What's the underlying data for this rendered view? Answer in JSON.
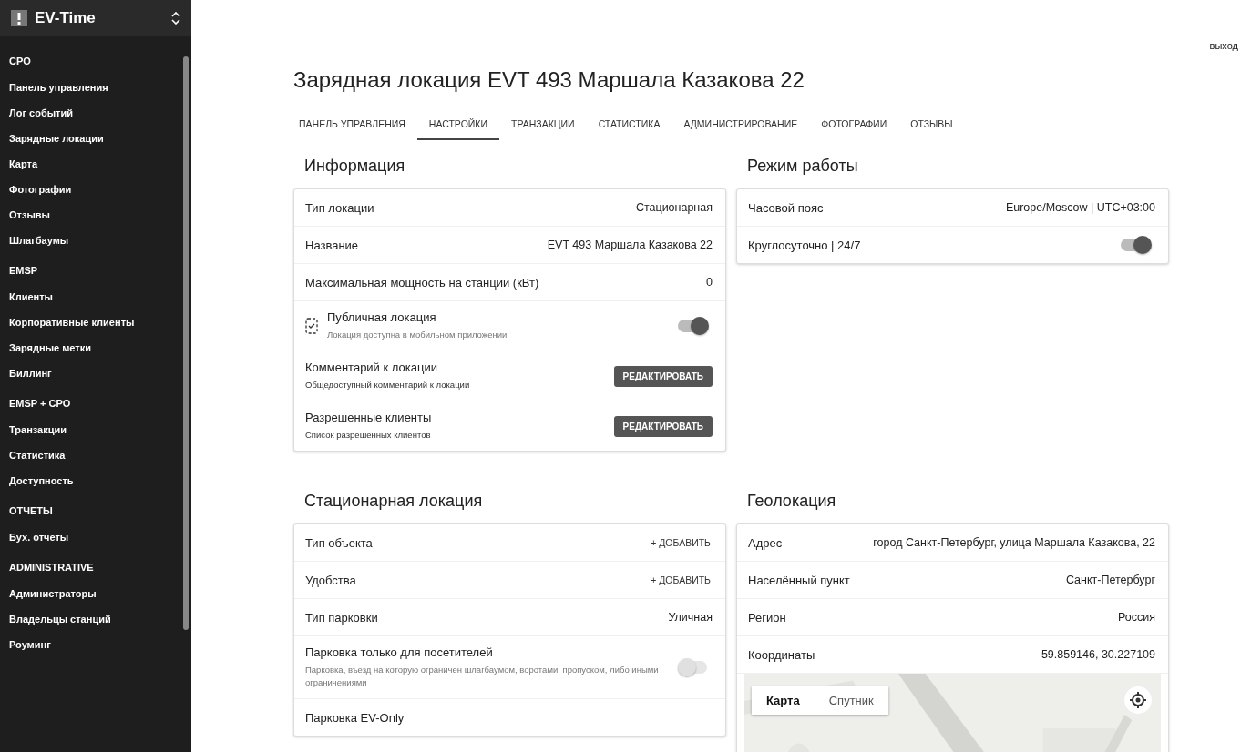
{
  "sidebar": {
    "brand": "EV-Time",
    "sections": [
      {
        "title": "CPO",
        "items": [
          {
            "label": "Панель управления"
          },
          {
            "label": "Лог событий"
          },
          {
            "label": "Зарядные локации"
          },
          {
            "label": "Карта"
          },
          {
            "label": "Фотографии"
          },
          {
            "label": "Отзывы"
          },
          {
            "label": "Шлагбаумы"
          }
        ]
      },
      {
        "title": "EMSP",
        "items": [
          {
            "label": "Клиенты"
          },
          {
            "label": "Корпоративные клиенты"
          },
          {
            "label": "Зарядные метки"
          },
          {
            "label": "Биллинг"
          }
        ]
      },
      {
        "title": "EMSP + CPO",
        "items": [
          {
            "label": "Транзакции"
          },
          {
            "label": "Статистика"
          },
          {
            "label": "Доступность"
          }
        ]
      },
      {
        "title": "ОТЧЕТЫ",
        "items": [
          {
            "label": "Бух. отчеты"
          }
        ]
      },
      {
        "title": "ADMINISTRATIVE",
        "items": [
          {
            "label": "Администраторы"
          },
          {
            "label": "Владельцы станций"
          },
          {
            "label": "Роуминг"
          }
        ]
      }
    ]
  },
  "logout": "выход",
  "title": "Зарядная локация EVT 493 Маршала Казакова 22",
  "tabs": [
    {
      "label": "ПАНЕЛЬ УПРАВЛЕНИЯ",
      "selected": false
    },
    {
      "label": "НАСТРОЙКИ",
      "selected": true
    },
    {
      "label": "ТРАНЗАКЦИИ",
      "selected": false
    },
    {
      "label": "СТАТИСТИКА",
      "selected": false
    },
    {
      "label": "АДМИНИСТРИРОВАНИЕ",
      "selected": false
    },
    {
      "label": "ФОТОГРАФИИ",
      "selected": false
    },
    {
      "label": "ОТЗЫВЫ",
      "selected": false
    }
  ],
  "left": [
    {
      "title": "Информация",
      "rows": [
        {
          "kind": "value",
          "label": "Тип локации",
          "value": "Стационарная"
        },
        {
          "kind": "value",
          "label": "Название",
          "value": "EVT 493 Маршала Казакова 22"
        },
        {
          "kind": "value",
          "label": "Максимальная мощность на станции (кВт)",
          "value": "0"
        },
        {
          "kind": "toggle",
          "icon": true,
          "label": "Публичная локация",
          "hint": "Локация доступна в мобильном приложении",
          "on": true
        },
        {
          "kind": "edit",
          "label": "Комментарий к локации",
          "hint": "Общедоступный комментарий к локации",
          "button": "РЕДАКТИРОВАТЬ"
        },
        {
          "kind": "edit",
          "label": "Разрешенные клиенты",
          "hint": "Список разрешенных клиентов",
          "button": "РЕДАКТИРОВАТЬ"
        }
      ]
    },
    {
      "title": "Стационарная локация",
      "rows": [
        {
          "kind": "add",
          "label": "Тип объекта",
          "button": "+ ДОБАВИТЬ"
        },
        {
          "kind": "add",
          "label": "Удобства",
          "button": "+ ДОБАВИТЬ"
        },
        {
          "kind": "value",
          "label": "Тип парковки",
          "value": "Уличная"
        },
        {
          "kind": "toggle",
          "label": "Парковка только для посетителей",
          "hint": "Парковка, въезд на которую ограничен шлагбаумом, воротами, пропуском, либо иными ограничениями",
          "on": false
        },
        {
          "kind": "value",
          "label": "Парковка EV-Only"
        }
      ]
    }
  ],
  "right": [
    {
      "title": "Режим работы",
      "rows": [
        {
          "kind": "value",
          "label": "Часовой пояс",
          "value": "Europe/Moscow | UTC+03:00"
        },
        {
          "kind": "toggle",
          "label": "Круглосуточно | 24/7",
          "on": true
        }
      ]
    },
    {
      "title": "Геолокация",
      "rows": [
        {
          "kind": "value",
          "label": "Адрес",
          "value": "город Санкт-Петербург, улица Маршала Казакова, 22"
        },
        {
          "kind": "value",
          "label": "Населённый пункт",
          "value": "Санкт-Петербург"
        },
        {
          "kind": "value",
          "label": "Регион",
          "value": "Россия"
        },
        {
          "kind": "value",
          "label": "Координаты",
          "value": "59.859146, 30.227109"
        }
      ],
      "map": {
        "kind": "picture",
        "types": [
          {
            "label": "Карта",
            "selected": true
          },
          {
            "label": "Спутник",
            "selected": false
          }
        ]
      }
    }
  ]
}
